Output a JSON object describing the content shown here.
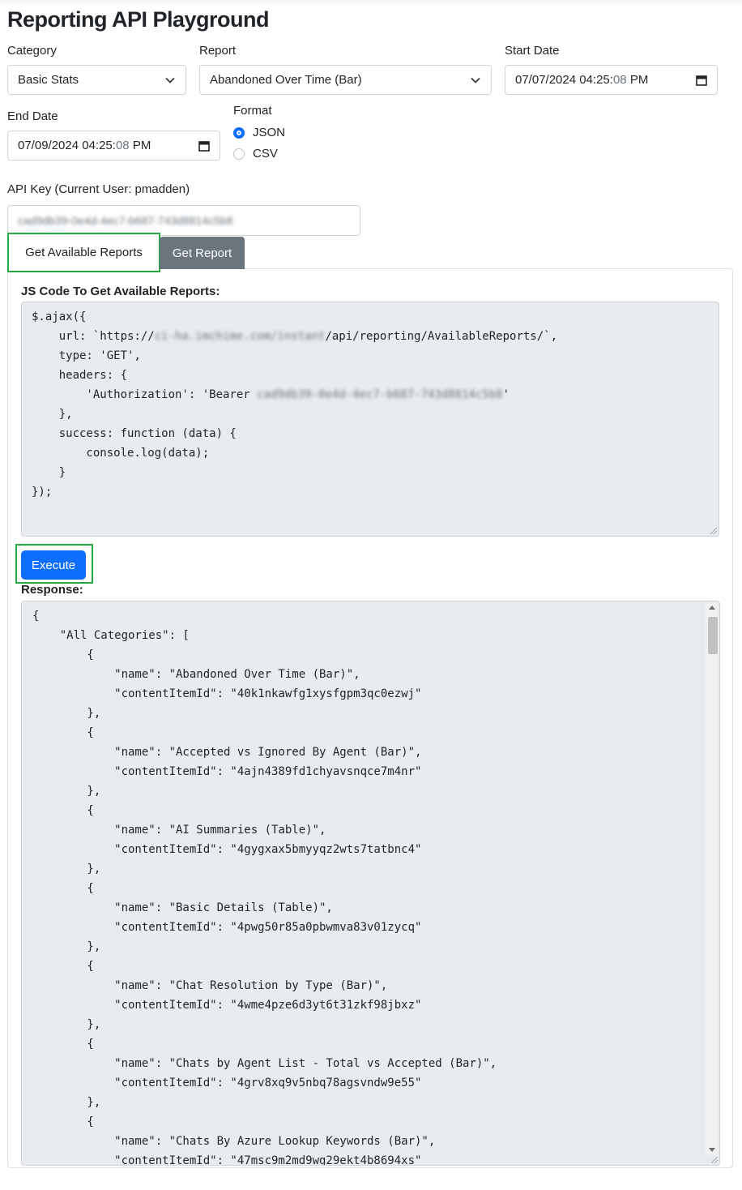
{
  "page": {
    "title": "Reporting API Playground"
  },
  "form": {
    "category": {
      "label": "Category",
      "value": "Basic Stats"
    },
    "report": {
      "label": "Report",
      "value": "Abandoned Over Time (Bar)"
    },
    "start_date": {
      "label": "Start Date",
      "value_main": "07/07/2024 04:25:",
      "value_seconds": "08",
      "value_ampm": "PM"
    },
    "end_date": {
      "label": "End Date",
      "value_main": "07/09/2024 04:25:",
      "value_seconds": "08",
      "value_ampm": "PM"
    },
    "format": {
      "label": "Format",
      "options": [
        "JSON",
        "CSV"
      ],
      "selected": "JSON"
    },
    "api_key": {
      "label": "API Key (Current User: pmadden)",
      "value": "cad9db39-0e4d-4ec7-b687-743d8814c5b8"
    }
  },
  "tabs": [
    {
      "label": "Get Available Reports",
      "active": true
    },
    {
      "label": "Get Report",
      "active": false
    }
  ],
  "code_section": {
    "title": "JS Code To Get Available Reports:",
    "lines": {
      "l1": "$.ajax({",
      "l2_pre": "    url: `https://",
      "l2_host": "ci-ha.imchime.com/instant",
      "l2_post": "/api/reporting/AvailableReports/`,",
      "l3": "    type: 'GET',",
      "l4": "    headers: {",
      "l5_pre": "        'Authorization': 'Bearer ",
      "l5_key": "cad9db39-0e4d-4ec7-b687-743d8814c5b8",
      "l5_post": "'",
      "l6": "    },",
      "l7": "    success: function (data) {",
      "l8": "        console.log(data);",
      "l9": "    }",
      "l10": "});"
    }
  },
  "execute": {
    "label": "Execute"
  },
  "response": {
    "label": "Response:",
    "text": "{\n    \"All Categories\": [\n        {\n            \"name\": \"Abandoned Over Time (Bar)\",\n            \"contentItemId\": \"40k1nkawfg1xysfgpm3qc0ezwj\"\n        },\n        {\n            \"name\": \"Accepted vs Ignored By Agent (Bar)\",\n            \"contentItemId\": \"4ajn4389fd1chyavsnqce7m4nr\"\n        },\n        {\n            \"name\": \"AI Summaries (Table)\",\n            \"contentItemId\": \"4gygxax5bmyyqz2wts7tatbnc4\"\n        },\n        {\n            \"name\": \"Basic Details (Table)\",\n            \"contentItemId\": \"4pwg50r85a0pbwmva83v01zycq\"\n        },\n        {\n            \"name\": \"Chat Resolution by Type (Bar)\",\n            \"contentItemId\": \"4wme4pze6d3yt6t31zkf98jbxz\"\n        },\n        {\n            \"name\": \"Chats by Agent List - Total vs Accepted (Bar)\",\n            \"contentItemId\": \"4grv8xq9v5nbq78agsvndw9e55\"\n        },\n        {\n            \"name\": \"Chats By Azure Lookup Keywords (Bar)\",\n            \"contentItemId\": \"47msc9m2md9wg29ekt4b8694xs\""
  },
  "colors": {
    "primary": "#0d6efd",
    "highlight": "#28a745",
    "secondary": "#6c757d",
    "code_bg": "#e9ecef"
  }
}
